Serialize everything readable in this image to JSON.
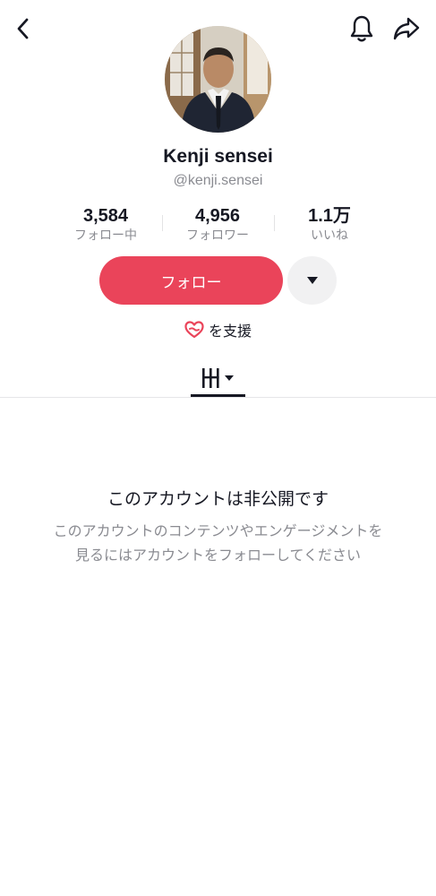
{
  "header": {
    "back_icon": "chevron-left-icon",
    "notification_icon": "bell-icon",
    "share_icon": "share-arrow-icon"
  },
  "profile": {
    "display_name": "Kenji sensei",
    "username": "@kenji.sensei"
  },
  "stats": [
    {
      "value": "3,584",
      "label": "フォロー中"
    },
    {
      "value": "4,956",
      "label": "フォロワー"
    },
    {
      "value": "1.1万",
      "label": "いいね"
    }
  ],
  "actions": {
    "follow_label": "フォロー",
    "more_icon": "caret-down-icon",
    "support_label": "を支援",
    "support_icon": "heart-hands-icon"
  },
  "tabs": {
    "videos_icon": "grid-bars-icon"
  },
  "private_notice": {
    "title": "このアカウントは非公開です",
    "description_line1": "このアカウントのコンテンツやエンゲージメントを",
    "description_line2": "見るにはアカウントをフォローしてください"
  },
  "colors": {
    "accent": "#ea445a",
    "text_primary": "#161823",
    "text_secondary": "#8a8b91"
  }
}
